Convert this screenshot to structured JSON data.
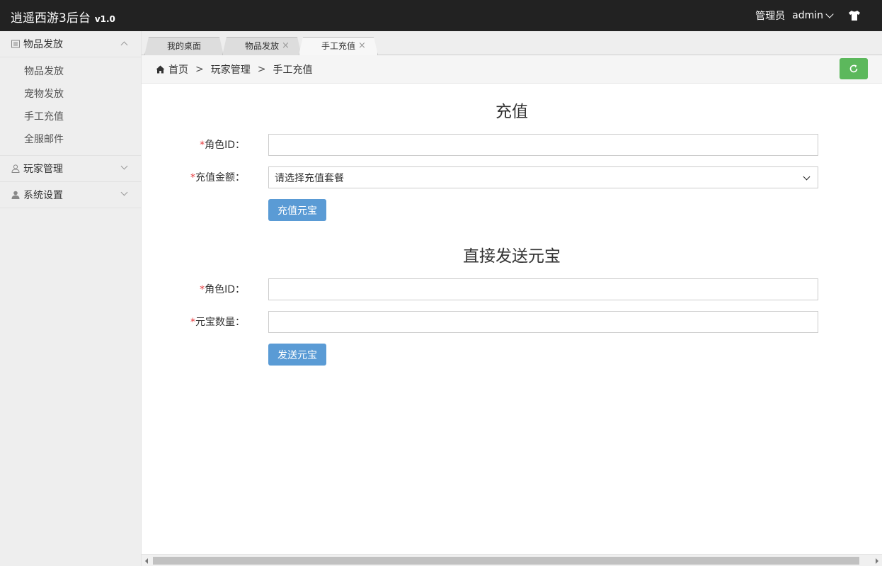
{
  "header": {
    "title": "逍遥西游3后台",
    "version": "v1.0",
    "role_label": "管理员",
    "username": "admin",
    "icons": [
      "chevron-down-icon",
      "tshirt-icon"
    ]
  },
  "sidebar": {
    "groups": [
      {
        "label": "物品发放",
        "icon": "list-icon",
        "expanded": true,
        "items": [
          {
            "label": "物品发放"
          },
          {
            "label": "宠物发放"
          },
          {
            "label": "手工充值"
          },
          {
            "label": "全服邮件"
          }
        ]
      },
      {
        "label": "玩家管理",
        "icon": "user-outline-icon",
        "expanded": false
      },
      {
        "label": "系统设置",
        "icon": "user-icon",
        "expanded": false
      }
    ]
  },
  "tabs": [
    {
      "label": "我的桌面",
      "closable": false,
      "active": false
    },
    {
      "label": "物品发放",
      "closable": true,
      "close": "×",
      "active": false
    },
    {
      "label": "手工充值",
      "closable": true,
      "close": "×",
      "active": true
    }
  ],
  "breadcrumb": {
    "items": [
      "首页",
      "玩家管理",
      "手工充值"
    ],
    "separator": ">"
  },
  "recharge": {
    "title": "充值",
    "role_id_label": "角色ID：",
    "role_id_value": "",
    "amount_label": "充值金额：",
    "amount_selected": "请选择充值套餐",
    "submit_label": "充值元宝"
  },
  "direct": {
    "title": "直接发送元宝",
    "role_id_label": "角色ID：",
    "role_id_value": "",
    "count_label": "元宝数量：",
    "count_value": "",
    "submit_label": "发送元宝"
  },
  "required_mark": "*",
  "colors": {
    "topbar_bg": "#222222",
    "sidebar_bg": "#eeeeee",
    "primary_button": "#5a9bd5",
    "refresh_button": "#5cb85c",
    "required": "#e4393c"
  }
}
